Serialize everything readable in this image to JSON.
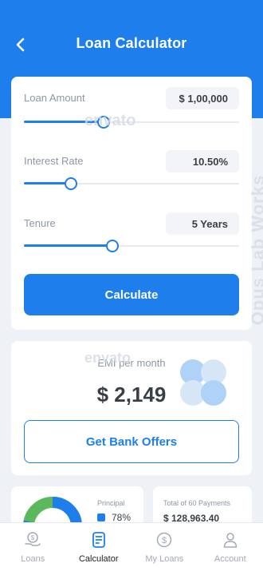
{
  "header": {
    "title": "Loan Calculator"
  },
  "colors": {
    "primary": "#1e7fec",
    "principal": "#1e7fec",
    "interest": "#5cb85c"
  },
  "inputs": {
    "loan_amount": {
      "label": "Loan Amount",
      "value": "$ 1,00,000",
      "level": 0.37
    },
    "interest_rate": {
      "label": "Interest Rate",
      "value": "10.50%",
      "level": 0.22
    },
    "tenure": {
      "label": "Tenure",
      "value": "5 Years",
      "level": 0.41
    }
  },
  "calculate_label": "Calculate",
  "emi": {
    "label": "EMI per month",
    "value": "$ 2,149"
  },
  "offers_label": "Get Bank Offers",
  "summary": {
    "principal_label": "Principal",
    "principal_pct": "78%",
    "principal_share": 0.78,
    "payments_label": "Total of 60 Payments",
    "payments_value": "$ 128,963.40"
  },
  "watermarks": {
    "envato": "envato",
    "vertical": "Opus Lab Works"
  },
  "nav": [
    {
      "label": "Loans",
      "icon": "hand-dollar-icon",
      "active": false
    },
    {
      "label": "Calculator",
      "icon": "calculator-icon",
      "active": true
    },
    {
      "label": "My Loans",
      "icon": "dollar-circle-icon",
      "active": false
    },
    {
      "label": "Account",
      "icon": "user-icon",
      "active": false
    }
  ]
}
